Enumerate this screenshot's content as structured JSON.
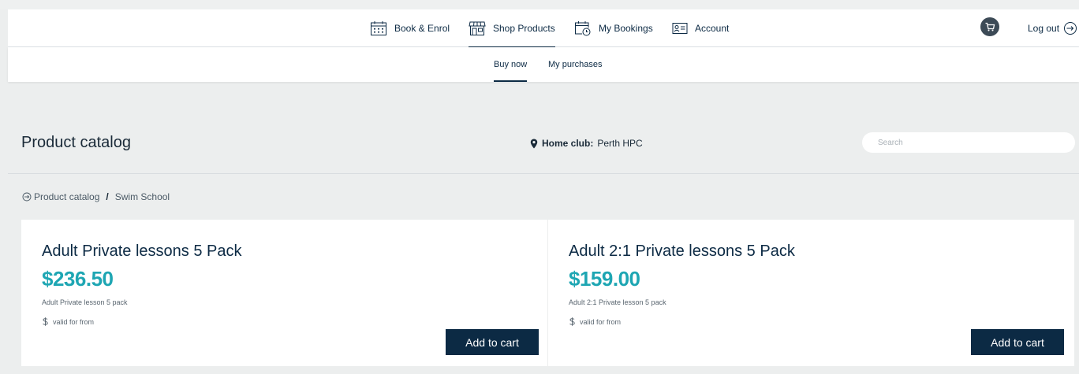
{
  "nav": {
    "items": [
      {
        "label": "Book & Enrol",
        "icon": "calendar-icon"
      },
      {
        "label": "Shop Products",
        "icon": "store-icon"
      },
      {
        "label": "My Bookings",
        "icon": "calendar-clock-icon"
      },
      {
        "label": "Account",
        "icon": "id-card-icon"
      }
    ],
    "active": "Shop Products",
    "cart_icon": "cart-icon",
    "logout_label": "Log out"
  },
  "subnav": {
    "items": [
      "Buy now",
      "My purchases"
    ],
    "active": "Buy now"
  },
  "page": {
    "title": "Product catalog",
    "home_club_label": "Home club:",
    "home_club_value": "Perth HPC",
    "search_placeholder": "Search"
  },
  "breadcrumb": {
    "root": "Product catalog",
    "separator": "/",
    "current": "Swim School"
  },
  "products": [
    {
      "name": "Adult Private lessons 5 Pack",
      "price": "$236.50",
      "description": "Adult Private lesson 5 pack",
      "validity": "valid for from",
      "button": "Add to cart"
    },
    {
      "name": "Adult 2:1 Private lessons 5 Pack",
      "price": "$159.00",
      "description": "Adult 2:1 Private lesson 5 pack",
      "validity": "valid for from",
      "button": "Add to cart"
    }
  ],
  "colors": {
    "brand_navy": "#0c2a44",
    "price_teal": "#1ea6b3",
    "background": "#eceeee"
  }
}
